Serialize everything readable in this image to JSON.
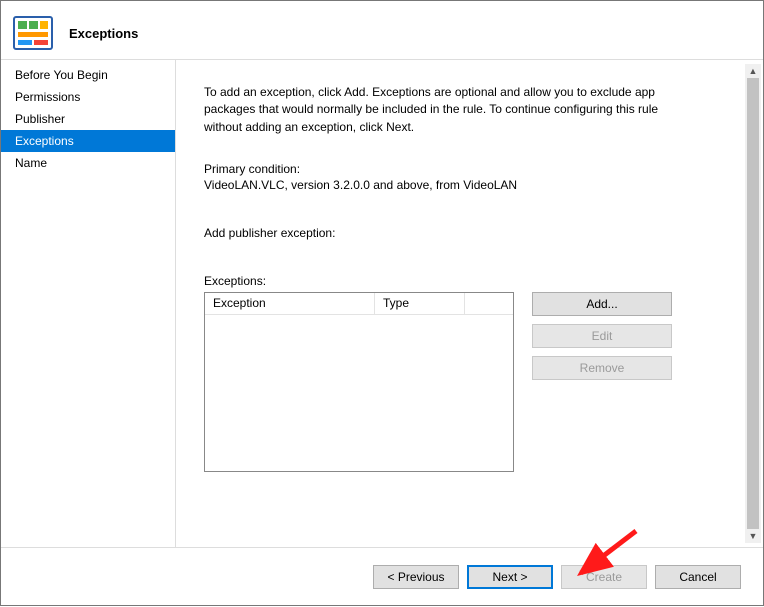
{
  "header": {
    "title": "Exceptions"
  },
  "sidebar": {
    "items": [
      {
        "label": "Before You Begin"
      },
      {
        "label": "Permissions"
      },
      {
        "label": "Publisher"
      },
      {
        "label": "Exceptions",
        "selected": true
      },
      {
        "label": "Name"
      }
    ]
  },
  "content": {
    "description": "To add an exception, click Add. Exceptions are optional and allow you to exclude app packages that would normally be included in the rule. To continue configuring this rule without adding an exception, click Next.",
    "primaryLabel": "Primary condition:",
    "primaryValue": "VideoLAN.VLC, version 3.2.0.0 and above, from VideoLAN",
    "addSublabel": "Add publisher exception:",
    "exceptionsLabel": "Exceptions:",
    "columns": {
      "c1": "Exception",
      "c2": "Type"
    },
    "buttons": {
      "add": "Add...",
      "edit": "Edit",
      "remove": "Remove"
    }
  },
  "footer": {
    "previous": "< Previous",
    "next": "Next >",
    "create": "Create",
    "cancel": "Cancel"
  }
}
